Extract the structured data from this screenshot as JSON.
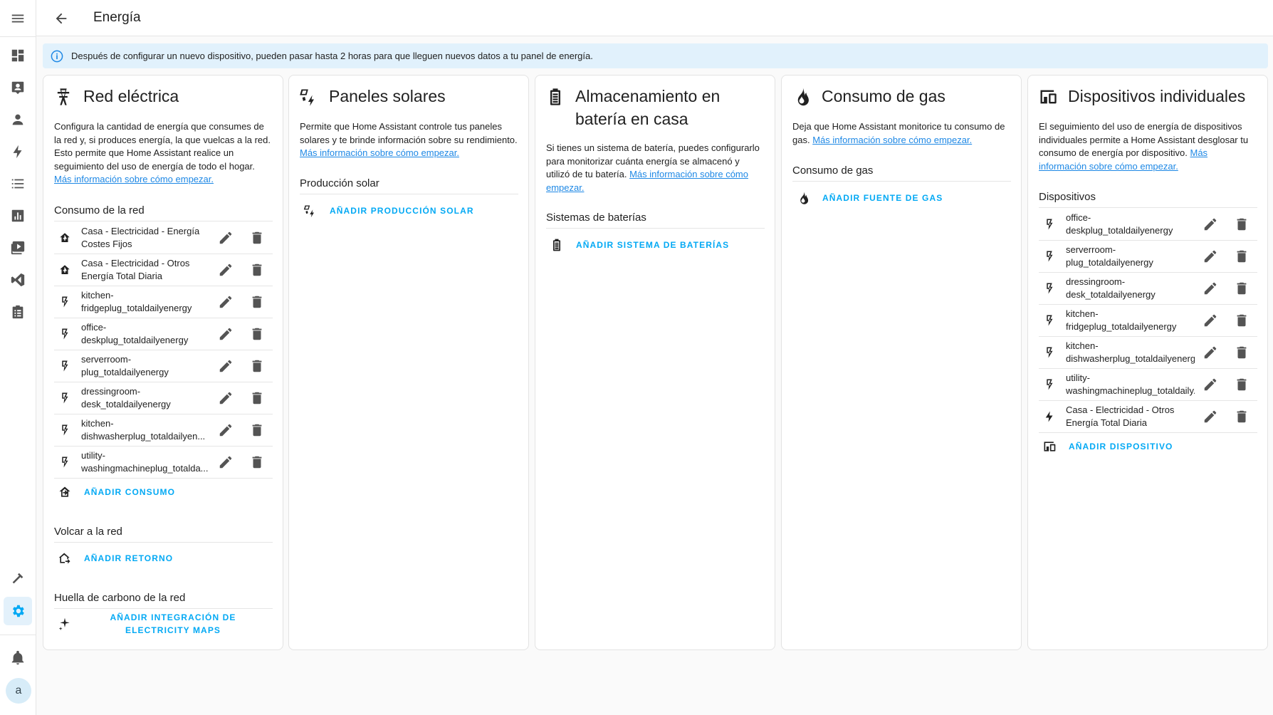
{
  "page": {
    "title": "Energía"
  },
  "alert": {
    "text": "Después de configurar un nuevo dispositivo, pueden pasar hasta 2 horas para que lleguen nuevos datos a tu panel de energía."
  },
  "sidebar": {
    "avatar_letter": "a"
  },
  "grid": {
    "title": "Red eléctrica",
    "desc": "Configura la cantidad de energía que consumes de la red y, si produces energía, la que vuelcas a la red. Esto permite que Home Assistant realice un seguimiento del uso de energía de todo el hogar.",
    "link": "Más información sobre cómo empezar.",
    "consumption_title": "Consumo de la red",
    "consumption": [
      "Casa - Electricidad - Energía Costes Fijos",
      "Casa - Electricidad - Otros Energía Total Diaria",
      "kitchen-fridgeplug_totaldailyenergy",
      "office-deskplug_totaldailyenergy",
      "serverroom-plug_totaldailyenergy",
      "dressingroom-desk_totaldailyenergy",
      "kitchen-dishwasherplug_totaldailyen...",
      "utility-washingmachineplug_totalda..."
    ],
    "add_consumption": "AÑADIR CONSUMO",
    "return_title": "Volcar a la red",
    "add_return": "AÑADIR RETORNO",
    "carbon_title": "Huella de carbono de la red",
    "add_carbon": "AÑADIR INTEGRACIÓN DE ELECTRICITY MAPS"
  },
  "solar": {
    "title": "Paneles solares",
    "desc": "Permite que Home Assistant controle tus paneles solares y te brinde información sobre su rendimiento.",
    "link": "Más información sobre cómo empezar.",
    "section_title": "Producción solar",
    "add": "AÑADIR PRODUCCIÓN SOLAR"
  },
  "battery": {
    "title": "Almacenamiento en batería en casa",
    "desc": "Si tienes un sistema de batería, puedes configurarlo para monitorizar cuánta energía se almacenó y utilizó de tu batería.",
    "link": "Más información sobre cómo empezar.",
    "section_title": "Sistemas de baterías",
    "add": "AÑADIR SISTEMA DE BATERÍAS"
  },
  "gas": {
    "title": "Consumo de gas",
    "desc": "Deja que Home Assistant monitorice tu consumo de gas.",
    "link": "Más información sobre cómo empezar.",
    "section_title": "Consumo de gas",
    "add": "AÑADIR FUENTE DE GAS"
  },
  "devices": {
    "title": "Dispositivos individuales",
    "desc": "El seguimiento del uso de energía de dispositivos individuales permite a Home Assistant desglosar tu consumo de energía por dispositivo.",
    "link": "Más información sobre cómo empezar.",
    "section_title": "Dispositivos",
    "items": [
      "office-deskplug_totaldailyenergy",
      "serverroom-plug_totaldailyenergy",
      "dressingroom-desk_totaldailyenergy",
      "kitchen-fridgeplug_totaldailyenergy",
      "kitchen-dishwasherplug_totaldailyenergy",
      "utility-washingmachineplug_totaldaily...",
      "Casa - Electricidad - Otros Energía Total Diaria"
    ],
    "add": "AÑADIR DISPOSITIVO"
  }
}
